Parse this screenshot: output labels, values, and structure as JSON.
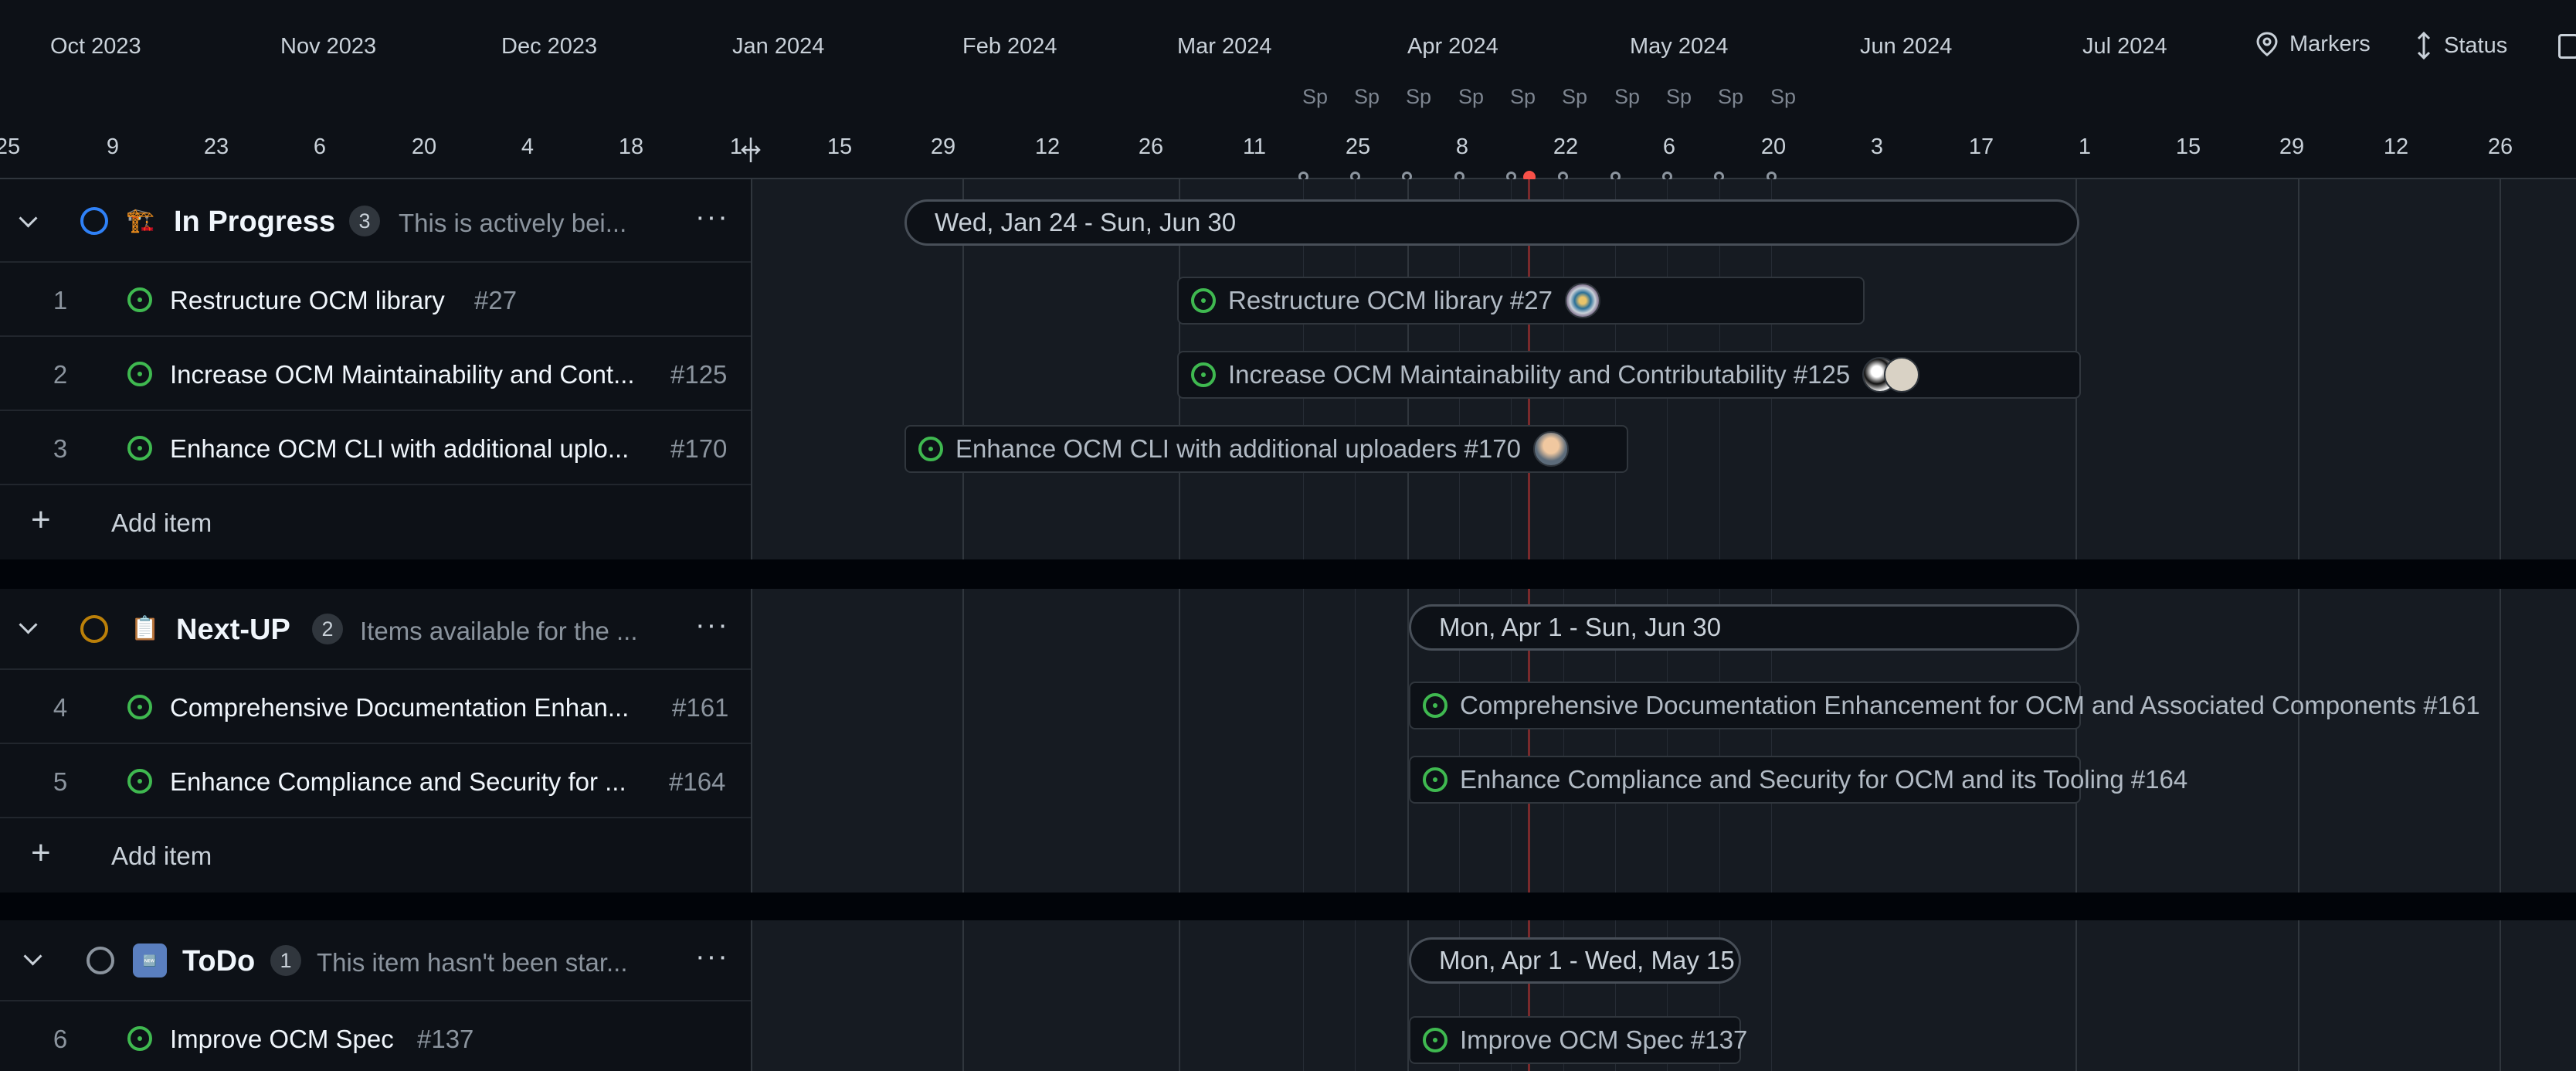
{
  "header": {
    "months": [
      "Oct 2023",
      "Nov 2023",
      "Dec 2023",
      "Jan 2024",
      "Feb 2024",
      "Mar 2024",
      "Apr 2024",
      "May 2024",
      "Jun 2024",
      "Jul 2024"
    ],
    "days": [
      "25",
      "9",
      "23",
      "6",
      "20",
      "4",
      "18",
      "1",
      "15",
      "29",
      "12",
      "26",
      "11",
      "25",
      "8",
      "22",
      "6",
      "20",
      "3",
      "17",
      "1",
      "15",
      "29",
      "12",
      "26"
    ],
    "sprint_label": "Sp",
    "markers_label": "Markers",
    "status_label": "Status"
  },
  "groups": [
    {
      "name": "In Progress",
      "emoji": "🏗️",
      "status_color": "#2f81f7",
      "count": "3",
      "description": "This is actively bei...",
      "range": "Wed, Jan 24 - Sun, Jun 30",
      "items": [
        {
          "index": "1",
          "title": "Restructure OCM library",
          "number": "#27",
          "bar": "Restructure OCM library #27"
        },
        {
          "index": "2",
          "title": "Increase OCM Maintainability and Cont...",
          "number": "#125",
          "bar": "Increase OCM Maintainability and Contributability #125"
        },
        {
          "index": "3",
          "title": "Enhance OCM CLI with additional uplo...",
          "number": "#170",
          "bar": "Enhance OCM CLI with additional uploaders #170"
        }
      ]
    },
    {
      "name": "Next-UP",
      "emoji": "📋",
      "status_color": "#bb8009",
      "count": "2",
      "description": "Items available for the ...",
      "range": "Mon, Apr 1 - Sun, Jun 30",
      "items": [
        {
          "index": "4",
          "title": "Comprehensive Documentation Enhan...",
          "number": "#161",
          "bar": "Comprehensive Documentation Enhancement for OCM and Associated Components #161"
        },
        {
          "index": "5",
          "title": "Enhance Compliance and Security for ...",
          "number": "#164",
          "bar": "Enhance Compliance and Security for OCM and its Tooling #164"
        }
      ]
    },
    {
      "name": "ToDo",
      "emoji": "🆕",
      "status_color": "#8b949e",
      "count": "1",
      "description": "This item hasn't been star...",
      "range": "Mon, Apr 1 - Wed, May 15",
      "items": [
        {
          "index": "6",
          "title": "Improve OCM Spec",
          "number": "#137",
          "bar": "Improve OCM Spec #137"
        }
      ]
    }
  ],
  "add_item_label": "Add item",
  "colors": {
    "accent_green": "#3fb950",
    "today_red": "#f85149"
  }
}
